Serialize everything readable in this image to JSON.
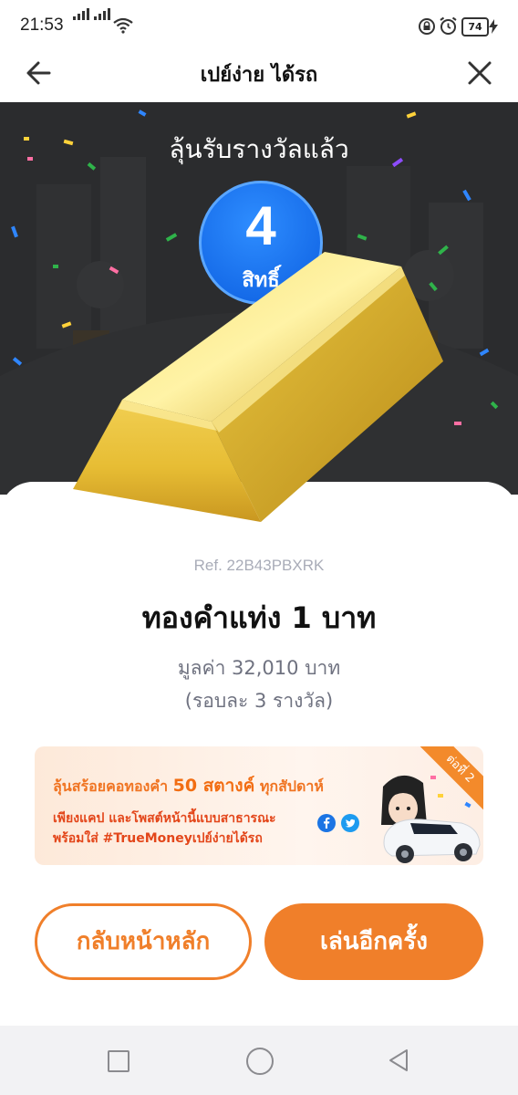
{
  "status_bar": {
    "time": "21:53",
    "battery": "74"
  },
  "header": {
    "title": "เปย์ง่าย ได้รถ"
  },
  "hero": {
    "title": "ลุ้นรับรางวัลแล้ว",
    "badge_count": "4",
    "badge_unit": "สิทธิ์"
  },
  "prize": {
    "ref": "Ref. 22B43PBXRK",
    "name": "ทองคำแท่ง 1 บาท",
    "value": "มูลค่า 32,010 บาท",
    "rounds": "(รอบละ 3 รางวัล)"
  },
  "promo": {
    "line1_prefix": "ลุ้นสร้อยคอทองคำ",
    "line1_highlight": "50 สตางค์",
    "line1_suffix": "ทุกสัปดาห์",
    "line2": "เพียงแคป และโพสต์หน้านี้แบบสาธารณะ",
    "line3": "พร้อมใส่ #TrueMoneyเปย์ง่ายได้รถ",
    "ribbon": "ต่อที่ 2"
  },
  "buttons": {
    "home": "กลับหน้าหลัก",
    "play_again": "เล่นอีกครั้ง"
  },
  "colors": {
    "accent": "#f07f2a",
    "badge": "#1f78f0",
    "hero_bg": "#2b2c2e"
  }
}
